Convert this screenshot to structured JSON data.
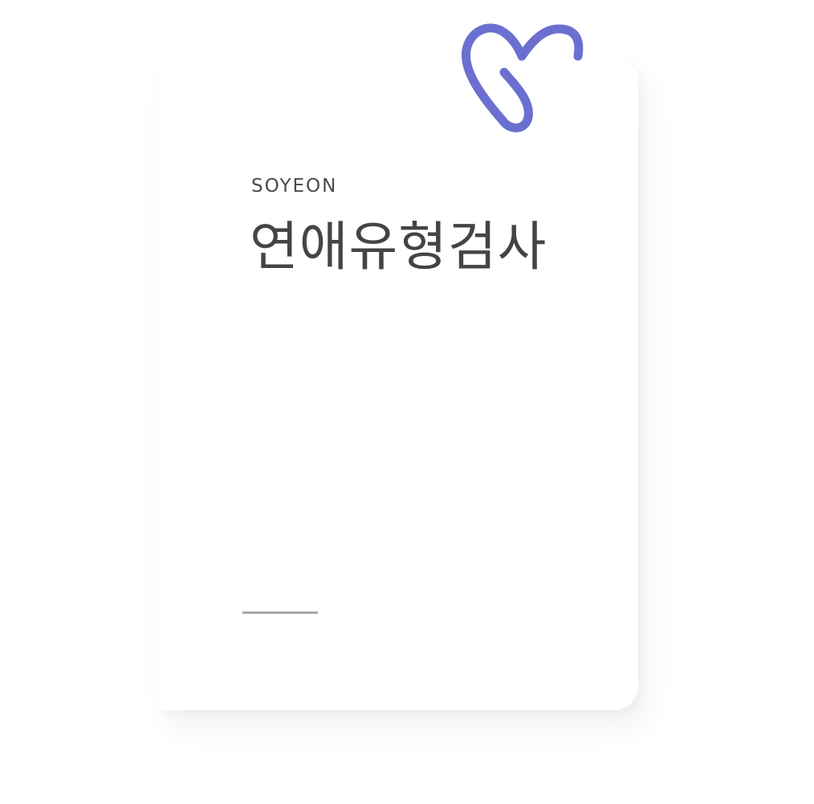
{
  "header": {
    "brand": "SOYEON",
    "title": "연애유형검사"
  },
  "colors": {
    "accent": "#6b6fcf",
    "background": "#ffffff",
    "text": "#444444",
    "divider": "#a8a8a8"
  },
  "icons": {
    "clip": "heart-paperclip-icon"
  }
}
